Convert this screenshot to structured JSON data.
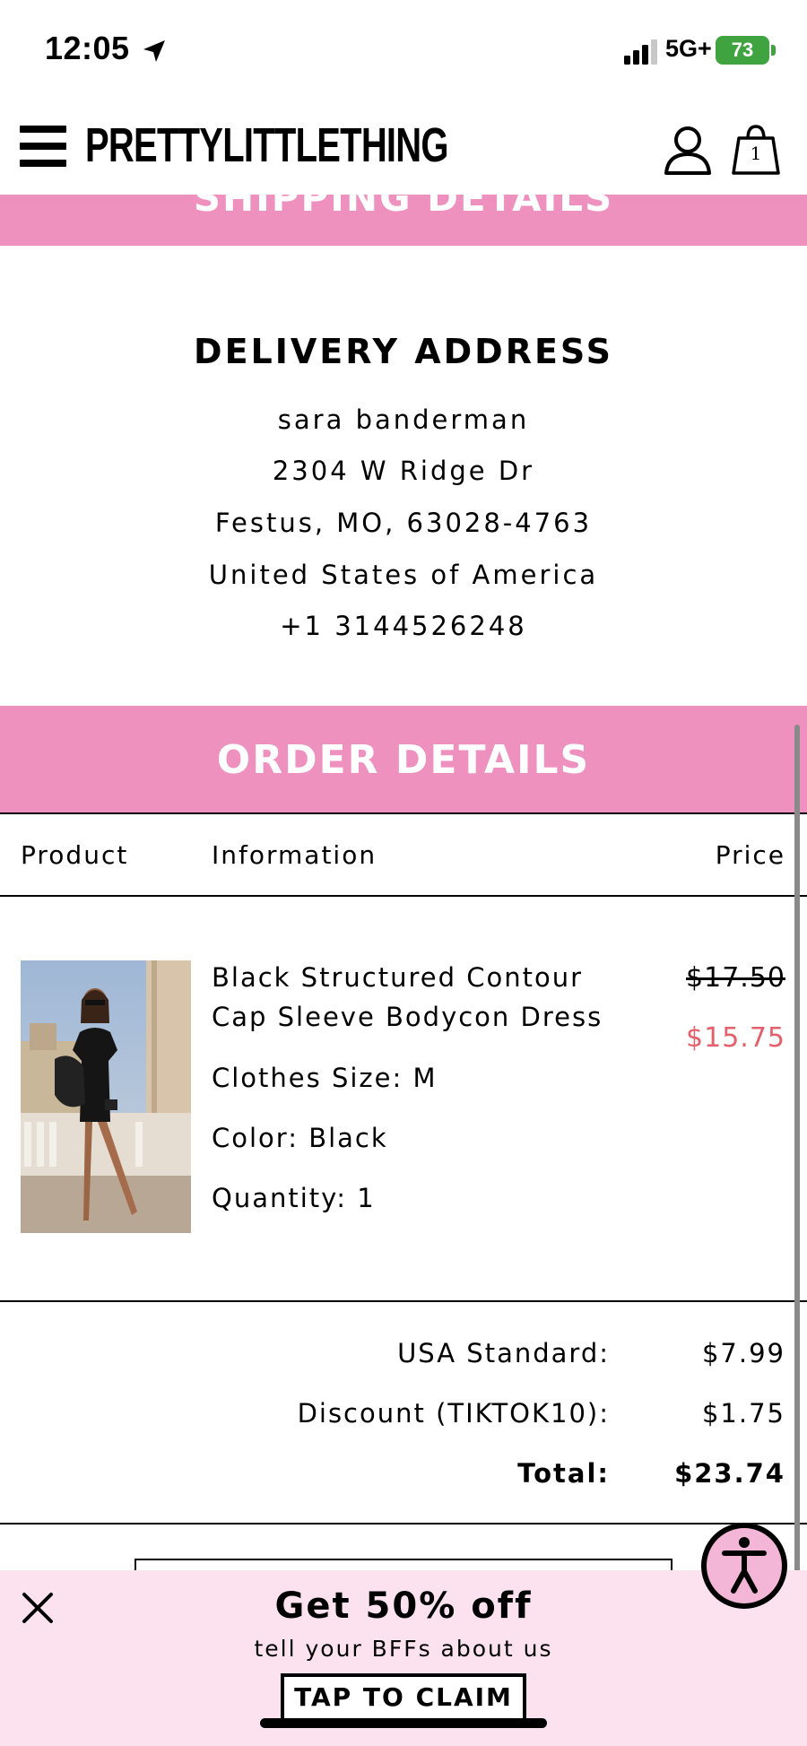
{
  "status_bar": {
    "time": "12:05",
    "network": "5G+",
    "battery": "73"
  },
  "header": {
    "brand": "PRETTYLITTLETHING",
    "bag_count": "1"
  },
  "shipping_section": {
    "label": "SHIPPING DETAILS"
  },
  "delivery_address": {
    "title": "DELIVERY ADDRESS",
    "lines": [
      "sara banderman",
      "2304 W Ridge Dr",
      "Festus, MO, 63028-4763",
      "United States of America",
      "+1 3144526248"
    ]
  },
  "order_details": {
    "title": "ORDER DETAILS",
    "columns": [
      "Product",
      "Information",
      "Price"
    ],
    "item": {
      "name": "Black Structured Contour Cap Sleeve Bodycon Dress",
      "size": "Clothes Size: M",
      "color": "Color: Black",
      "quantity": "Quantity: 1",
      "original_price": "$17.50",
      "sale_price": "$15.75"
    },
    "summary": [
      {
        "label": "USA Standard:",
        "value": "$7.99"
      },
      {
        "label": "Discount (TIKTOK10):",
        "value": "$1.75"
      },
      {
        "label": "Total:",
        "value": "$23.74"
      }
    ]
  },
  "promo": {
    "title": "Get 50% off",
    "subtitle": "tell your BFFs about us",
    "cta": "TAP TO CLAIM"
  },
  "colors": {
    "pink_banner": "#ef91bf",
    "promo_bg": "#fbe2ee",
    "sale_red": "#e4606a",
    "battery_green": "#3fa33f"
  }
}
